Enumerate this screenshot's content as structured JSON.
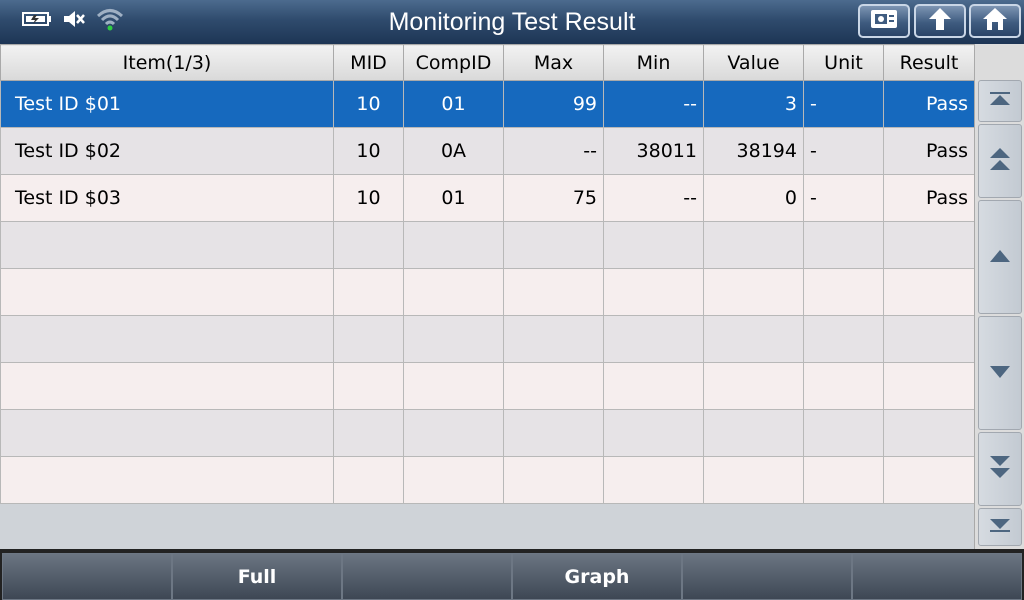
{
  "header": {
    "title": "Monitoring Test Result",
    "icons": [
      "battery-icon",
      "mute-icon",
      "wifi-icon"
    ],
    "buttons": [
      "print-icon",
      "back-icon",
      "home-icon"
    ]
  },
  "table": {
    "columns": [
      "Item(1/3)",
      "MID",
      "CompID",
      "Max",
      "Min",
      "Value",
      "Unit",
      "Result"
    ],
    "rows": [
      {
        "item": "Test ID $01",
        "mid": "10",
        "compid": "01",
        "max": "99",
        "min": "--",
        "value": "3",
        "unit": "-",
        "result": "Pass"
      },
      {
        "item": "Test ID $02",
        "mid": "10",
        "compid": "0A",
        "max": "--",
        "min": "38011",
        "value": "38194",
        "unit": "-",
        "result": "Pass"
      },
      {
        "item": "Test ID $03",
        "mid": "10",
        "compid": "01",
        "max": "75",
        "min": "--",
        "value": "0",
        "unit": "-",
        "result": "Pass"
      }
    ],
    "selected_row": 0
  },
  "footer": {
    "buttons": [
      "",
      "Full",
      "",
      "Graph",
      "",
      ""
    ]
  },
  "colors": {
    "selected": "#1669be",
    "header_bar": "#2f4b6d"
  }
}
